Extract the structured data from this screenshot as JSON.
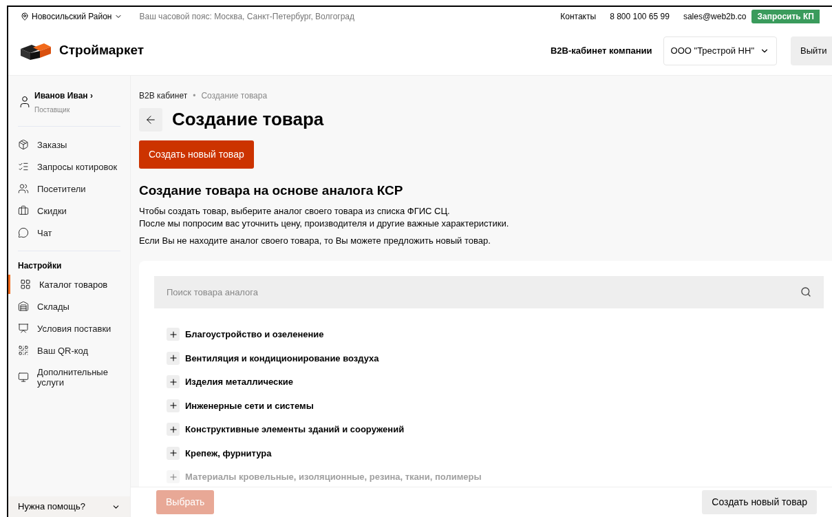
{
  "topbar": {
    "region": "Новосильский Район",
    "timezone": "Ваш часовой пояс: Москва, Санкт-Петербург, Волгоград",
    "contacts": "Контакты",
    "phone": "8 800 100 65 99",
    "email": "sales@web2b.co",
    "cta": "Запросить КП"
  },
  "header": {
    "logo": "Строймаркет",
    "cabinet": "B2B-кабинет компании",
    "company": "ООО \"Трестрой НН\"",
    "logout": "Выйти"
  },
  "user": {
    "name": "Иванов Иван",
    "arrow": "›",
    "role": "Поставщик"
  },
  "sidebar": {
    "items": [
      {
        "label": "Заказы",
        "kind": "boxes",
        "selected": false
      },
      {
        "label": "Запросы котировок",
        "kind": "quotes",
        "selected": false
      },
      {
        "label": "Посетители",
        "kind": "people",
        "selected": false
      },
      {
        "label": "Скидки",
        "kind": "bag",
        "selected": false
      },
      {
        "label": "Чат",
        "kind": "chat",
        "selected": false
      }
    ],
    "settings_title": "Настройки",
    "settings_items": [
      {
        "label": "Каталог товаров",
        "kind": "grid",
        "selected": true
      },
      {
        "label": "Склады",
        "kind": "warehouse",
        "selected": false
      },
      {
        "label": "Условия поставки",
        "kind": "board",
        "selected": false
      },
      {
        "label": "Ваш QR-код",
        "kind": "qr",
        "selected": false
      },
      {
        "label": "Дополнительные услуги",
        "kind": "monitor",
        "selected": false
      }
    ],
    "help": "Нужна помощь?"
  },
  "breadcrumbs": [
    "B2B кабинет",
    "•",
    "Создание товара"
  ],
  "title": "Создание товара",
  "create_button": "Создать новый товар",
  "section_title": "Создание товара на основе аналога КСР",
  "description": [
    "Чтобы создать товар, выберите аналог своего товара из списка ФГИС СЦ.",
    "После мы попросим вас уточнить цену, производителя и другие важные характеристики."
  ],
  "note": "Если Вы не находите аналог своего товара, то Вы можете предложить новый товар.",
  "search": {
    "placeholder": "Поиск товара аналога"
  },
  "categories": [
    {
      "label": "Благоустройство и озеленение",
      "expanded": false,
      "faded": false
    },
    {
      "label": "Вентиляция и кондиционирование воздуха",
      "expanded": false,
      "faded": false
    },
    {
      "label": "Изделия металлические",
      "expanded": false,
      "faded": false
    },
    {
      "label": "Инженерные сети и системы",
      "expanded": false,
      "faded": false
    },
    {
      "label": "Конструктивные элементы зданий и сооружений",
      "expanded": false,
      "faded": false
    },
    {
      "label": "Крепеж, фурнитура",
      "expanded": false,
      "faded": false
    },
    {
      "label": "Материалы кровельные, изоляционные, резина, ткани, полимеры",
      "expanded": false,
      "faded": true
    }
  ],
  "footer": {
    "select": "Выбрать",
    "select_disabled": true,
    "create": "Создать новый товар"
  }
}
